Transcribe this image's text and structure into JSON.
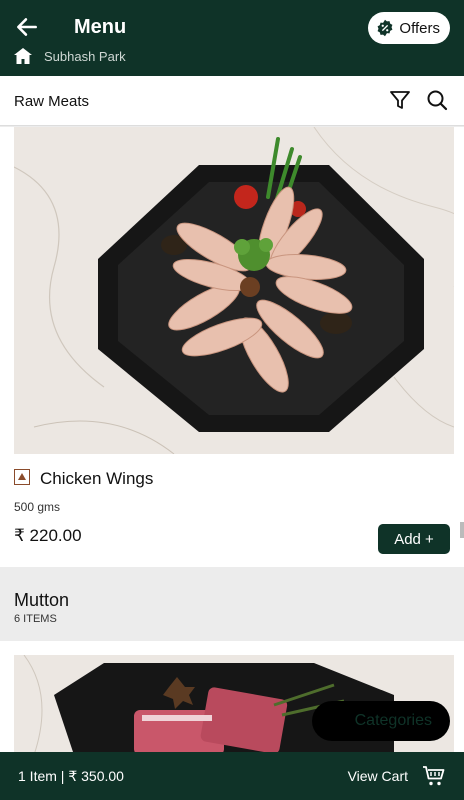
{
  "header": {
    "title": "Menu",
    "offers_label": "Offers",
    "location": "Subhash Park"
  },
  "category_bar": {
    "title": "Raw Meats"
  },
  "product": {
    "name": "Chicken Wings",
    "quantity": "500 gms",
    "price": "₹ 220.00",
    "add_label": "Add +"
  },
  "section": {
    "title": "Mutton",
    "count": "6 ITEMS"
  },
  "floating": {
    "categories_label": "Categories"
  },
  "footer": {
    "cart_summary": "1 Item | ₹ 350.00",
    "view_cart_label": "View Cart"
  },
  "colors": {
    "brand": "#0f3328",
    "accent_white": "#ffffff",
    "veg_mark": "#8a4b2b"
  },
  "icons": [
    "back-arrow-icon",
    "offers-badge-icon",
    "home-icon",
    "filter-icon",
    "search-icon",
    "cart-icon"
  ]
}
